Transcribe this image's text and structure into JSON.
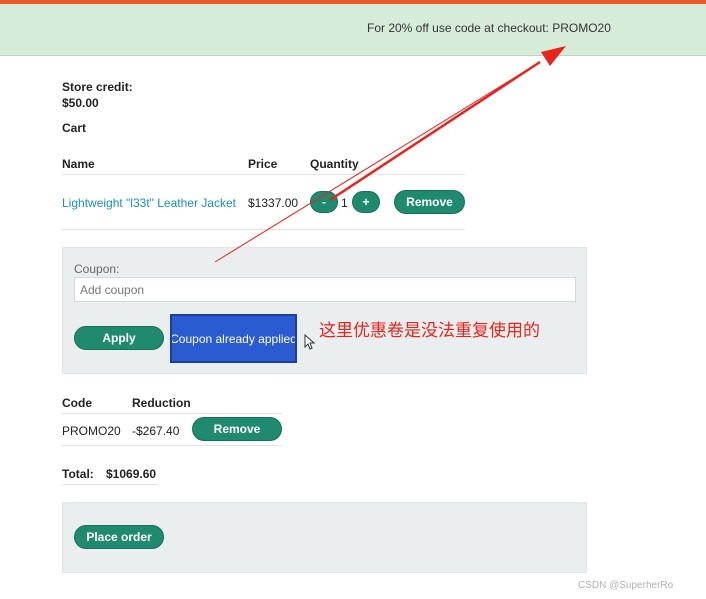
{
  "banner": {
    "text": "For 20% off use code at checkout: PROMO20"
  },
  "store_credit": {
    "label": "Store credit:",
    "value": "$50.00"
  },
  "cart": {
    "title": "Cart",
    "headers": [
      "Name",
      "Price",
      "Quantity"
    ],
    "items": [
      {
        "name": "Lightweight \"l33t\" Leather Jacket",
        "price": "$1337.00",
        "quantity": "1",
        "minus_label": "-",
        "plus_label": "+",
        "remove_label": "Remove"
      }
    ]
  },
  "coupon": {
    "label": "Coupon:",
    "placeholder": "Add coupon",
    "apply_label": "Apply",
    "applied_label": "Coupon already applied"
  },
  "annotation": {
    "text": "这里优惠卷是没法重复使用的",
    "color": "#e8241b"
  },
  "codes": {
    "headers": [
      "Code",
      "Reduction"
    ],
    "rows": [
      {
        "code": "PROMO20",
        "reduction": "-$267.40",
        "remove_label": "Remove"
      }
    ]
  },
  "total": {
    "label": "Total:",
    "value": "$1069.60"
  },
  "order": {
    "place_label": "Place order"
  },
  "watermark": {
    "text": "CSDN @SuperherRo"
  },
  "colors": {
    "accent": "#1f8a6e",
    "banner_bg": "#d6ecd9",
    "applied_btn": "#2a5bd0",
    "link": "#1a8fb8"
  }
}
